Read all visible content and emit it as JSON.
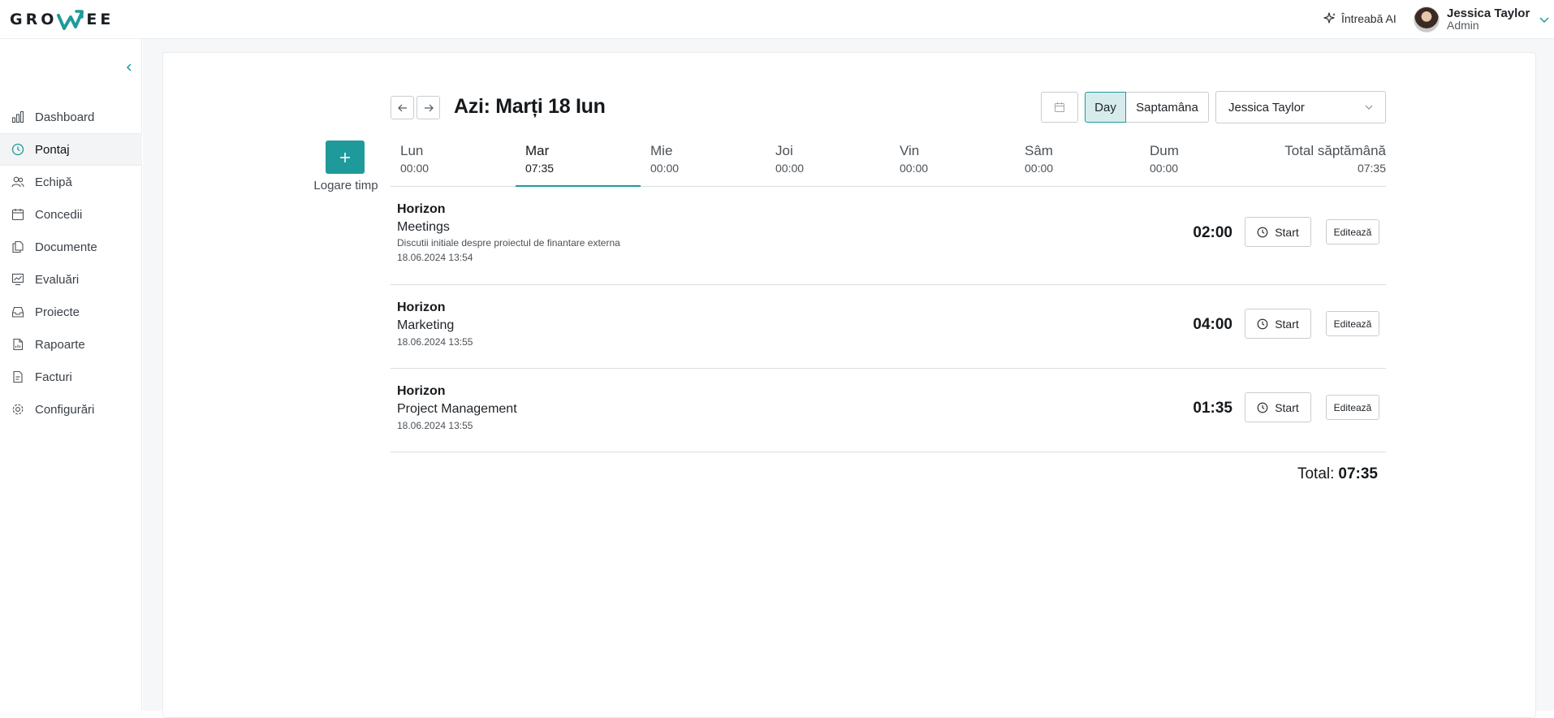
{
  "brand": {
    "logo_left": "GRO",
    "logo_right": "EE",
    "accent": "#1f9a9a"
  },
  "topbar": {
    "ask_ai": "Întreabă AI",
    "user_name": "Jessica Taylor",
    "user_role": "Admin"
  },
  "sidebar": {
    "items": [
      {
        "label": "Dashboard",
        "icon": "bar-chart-icon"
      },
      {
        "label": "Pontaj",
        "icon": "clock-icon",
        "active": true
      },
      {
        "label": "Echipă",
        "icon": "users-icon"
      },
      {
        "label": "Concedii",
        "icon": "calendar-icon"
      },
      {
        "label": "Documente",
        "icon": "documents-icon"
      },
      {
        "label": "Evaluări",
        "icon": "evaluation-icon"
      },
      {
        "label": "Proiecte",
        "icon": "inbox-icon"
      },
      {
        "label": "Rapoarte",
        "icon": "report-icon"
      },
      {
        "label": "Facturi",
        "icon": "invoice-icon"
      },
      {
        "label": "Configurări",
        "icon": "gear-icon"
      }
    ]
  },
  "toolbar": {
    "add_label": "Logare timp",
    "date_title": "Azi: Marți 18 Iun",
    "view_day": "Day",
    "view_week": "Saptamâna",
    "selected_user": "Jessica Taylor"
  },
  "week": {
    "days": [
      {
        "name": "Lun",
        "time": "00:00"
      },
      {
        "name": "Mar",
        "time": "07:35",
        "active": true
      },
      {
        "name": "Mie",
        "time": "00:00"
      },
      {
        "name": "Joi",
        "time": "00:00"
      },
      {
        "name": "Vin",
        "time": "00:00"
      },
      {
        "name": "Sâm",
        "time": "00:00"
      },
      {
        "name": "Dum",
        "time": "00:00"
      }
    ],
    "total_label": "Total săptămână",
    "total_time": "07:35"
  },
  "entries": [
    {
      "project": "Horizon",
      "task": "Meetings",
      "description": "Discutii initiale despre proiectul de finantare externa",
      "timestamp": "18.06.2024 13:54",
      "duration": "02:00",
      "start_label": "Start",
      "edit_label": "Editează"
    },
    {
      "project": "Horizon",
      "task": "Marketing",
      "description": "",
      "timestamp": "18.06.2024 13:55",
      "duration": "04:00",
      "start_label": "Start",
      "edit_label": "Editează"
    },
    {
      "project": "Horizon",
      "task": "Project Management",
      "description": "",
      "timestamp": "18.06.2024 13:55",
      "duration": "01:35",
      "start_label": "Start",
      "edit_label": "Editează"
    }
  ],
  "totals": {
    "label": "Total:",
    "value": "07:35"
  }
}
